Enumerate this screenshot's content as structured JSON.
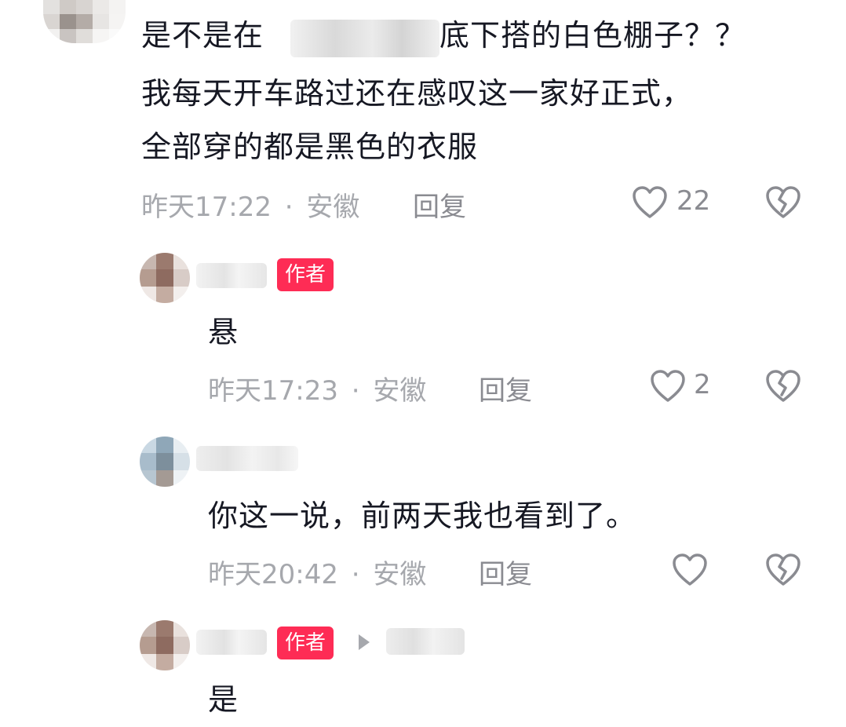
{
  "comments": [
    {
      "text_lines": [
        "是不是在",
        "底下搭的白色棚子？？",
        "我每天开车路过还在感叹这一家好正式，",
        "全部穿的都是黑色的衣服"
      ],
      "time": "昨天17:22",
      "location": "安徽",
      "reply_label": "回复",
      "likes": "22"
    },
    {
      "badge": "作者",
      "text": "悬",
      "time": "昨天17:23",
      "location": "安徽",
      "reply_label": "回复",
      "likes": "2"
    },
    {
      "text": "你这一说，前两天我也看到了。",
      "time": "昨天20:42",
      "location": "安徽",
      "reply_label": "回复",
      "likes": ""
    },
    {
      "badge": "作者",
      "text": "是"
    }
  ],
  "separator": "·",
  "icons": {
    "like": "heart-outline-icon",
    "dislike": "broken-heart-icon",
    "reply_to": "play-arrow-icon"
  },
  "colors": {
    "badge": "#fe2c55",
    "meta": "#a6a8ad",
    "text": "#161823"
  }
}
